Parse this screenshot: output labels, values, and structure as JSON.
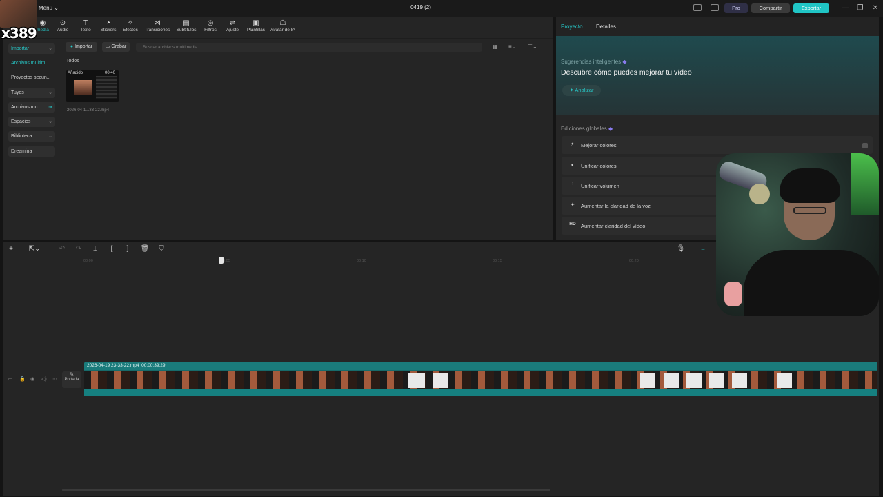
{
  "overlay": {
    "count": "x389"
  },
  "titlebar": {
    "menu": "Menú ⌄",
    "title": "0419 (2)",
    "pro": "Pro",
    "share": "Compartir",
    "export": "Exportar",
    "window_controls": [
      "—",
      "❐",
      "✕"
    ]
  },
  "toolbar": {
    "items": [
      {
        "label": "Multimedia",
        "icon": "media-icon"
      },
      {
        "label": "Audio",
        "icon": "audio-icon"
      },
      {
        "label": "Texto",
        "icon": "text-icon"
      },
      {
        "label": "Stickers",
        "icon": "sticker-icon"
      },
      {
        "label": "Efectos",
        "icon": "effects-icon"
      },
      {
        "label": "Transiciones",
        "icon": "transition-icon"
      },
      {
        "label": "Subtítulos",
        "icon": "subtitles-icon"
      },
      {
        "label": "Filtros",
        "icon": "filter-icon"
      },
      {
        "label": "Ajuste",
        "icon": "adjust-icon"
      },
      {
        "label": "Plantillas",
        "icon": "templates-icon"
      },
      {
        "label": "Avatar de IA",
        "icon": "ai-avatar-icon"
      }
    ],
    "active_label": "media",
    "icons": [
      "◉",
      "⊙",
      "T",
      "◔",
      "✧",
      "⋈",
      "▤",
      "◎",
      "⇌",
      "▣",
      "☖"
    ]
  },
  "left_nav": {
    "items": [
      {
        "label": "Importar",
        "chevron": "⌄"
      },
      {
        "label": "Archivos multim...",
        "chevron": ""
      },
      {
        "label": "Proyectos secun...",
        "chevron": ""
      },
      {
        "label": "Tuyos",
        "chevron": "⌄"
      },
      {
        "label": "Archivos mu...",
        "chevron": "⇥"
      },
      {
        "label": "Espacios",
        "chevron": "⌄"
      },
      {
        "label": "Biblioteca",
        "chevron": "⌄"
      },
      {
        "label": "Dreamina",
        "chevron": ""
      }
    ]
  },
  "media": {
    "import_label": "Importar",
    "record_label": "Grabar",
    "search_placeholder": "Buscar archivos multimedia",
    "filter_all": "Todos",
    "clip": {
      "added": "Añadido",
      "duration": "00:40",
      "name": "2026-04-1...33-22.mp4"
    }
  },
  "right_panel": {
    "tabs": [
      "Proyecto",
      "Detalles"
    ],
    "suggestions_title": "Sugerencias inteligentes",
    "suggestions_heading": "Descubre cómo puedes mejorar tu vídeo",
    "analyze_label": "Analizar",
    "global_title": "Ediciones globales",
    "global_items": [
      {
        "label": "Mejorar colores",
        "icon": "color-enhance-icon"
      },
      {
        "label": "Unificar colores",
        "icon": "color-unify-icon"
      },
      {
        "label": "Unificar volumen",
        "icon": "volume-unify-icon"
      },
      {
        "label": "Aumentar la claridad de la voz",
        "icon": "voice-clarity-icon"
      },
      {
        "label": "Aumentar claridad del vídeo",
        "icon": "hd-icon"
      }
    ],
    "global_icons": [
      "⚡",
      "◐",
      "⫶",
      "✦",
      "HD"
    ]
  },
  "timeline": {
    "ticks": [
      "00:00",
      "00:05",
      "00:10",
      "00:15",
      "00:20"
    ],
    "clip_label": "2026-04-19 23-33-22.mp4",
    "clip_duration": "00:00:39:29",
    "cover_label": "Portada"
  }
}
